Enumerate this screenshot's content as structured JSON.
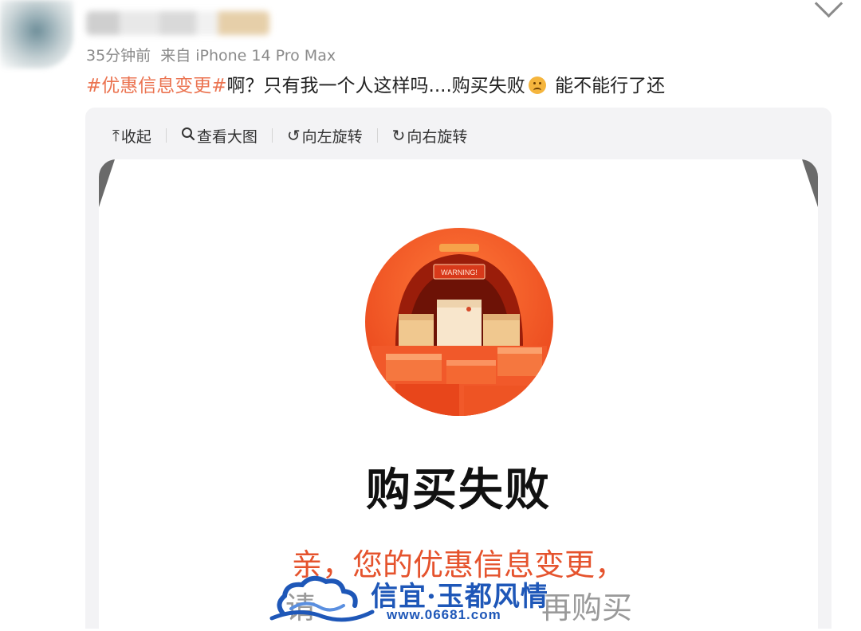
{
  "post": {
    "time_ago": "35分钟前",
    "source": "来自 iPhone 14 Pro Max",
    "hashtag": "#优惠信息变更#",
    "text": "啊？只有我一个人这样吗....购买失败",
    "text_after_emoji": " 能不能行了还",
    "emoji_icon": "sad-face-emoji"
  },
  "toolbar": {
    "collapse_label": "收起",
    "view_large_label": "查看大图",
    "rotate_left_label": "向左旋转",
    "rotate_right_label": "向右旋转"
  },
  "screenshot": {
    "badge_text": "WARNING!",
    "title": "购买失败",
    "message_line1": "亲，您的优惠信息变更，",
    "message_line2_visible_start": "请",
    "message_line2_visible_end": "再购买"
  },
  "watermark": {
    "brand": "信宜·玉都风情",
    "url": "www.06681.com"
  },
  "colors": {
    "hashtag": "#eb7350",
    "accent_orange": "#e5532d",
    "watermark_blue": "#1e57b8"
  }
}
